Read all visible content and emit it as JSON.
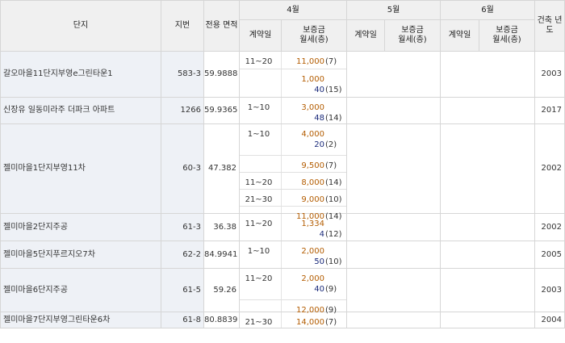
{
  "headers": {
    "complex": "단지",
    "jibun": "지번",
    "area": "전용 면적",
    "months": [
      "4월",
      "5월",
      "6월"
    ],
    "contract_date": "계약일",
    "deposit": "보증금",
    "rent": "월세(층)",
    "year_built": "건축 년도"
  },
  "rows": [
    {
      "name": "갈오마을11단지부영e그린타운1",
      "jibun": "583-3",
      "area": "59.9888",
      "year": "2003"
    },
    {
      "name": "신장유 일동미라주 더파크 아파트",
      "jibun": "1266",
      "area": "59.9365",
      "year": "2017"
    },
    {
      "name": "젤미마을1단지부영11차",
      "jibun": "60-3",
      "area": "47.382",
      "year": "2002"
    },
    {
      "name": "젤미마을2단지주공",
      "jibun": "61-3",
      "area": "36.38",
      "year": "2002"
    },
    {
      "name": "젤미마을5단지푸르지오7차",
      "jibun": "62-2",
      "area": "84.9941",
      "year": "2005"
    },
    {
      "name": "젤미마을6단지주공",
      "jibun": "61-5",
      "area": "59.26",
      "year": "2003"
    },
    {
      "name": "젤미마을7단지부영그린타운6차",
      "jibun": "61-8",
      "area": "80.8839",
      "year": "2004"
    }
  ],
  "april": [
    [
      {
        "date": "11~20",
        "deposit": "11,000",
        "floor": "(7)"
      },
      {
        "date": "",
        "deposit": "1,000",
        "rent": "40",
        "rent_floor": "(15)"
      }
    ],
    [
      {
        "date": "1~10",
        "deposit": "3,000",
        "rent": "48",
        "rent_floor": "(14)"
      }
    ],
    [
      {
        "date": "1~10",
        "deposit": "4,000",
        "rent": "20",
        "rent_floor": "(2)"
      },
      {
        "date": "",
        "deposit": "9,500",
        "floor": "(7)"
      },
      {
        "date": "11~20",
        "deposit": "8,000",
        "floor": "(14)"
      },
      {
        "date": "21~30",
        "deposit": "9,000",
        "floor": "(10)"
      },
      {
        "date": "",
        "deposit": "11,000",
        "floor": "(14)"
      }
    ],
    [
      {
        "date": "11~20",
        "deposit": "1,334",
        "rent": "4",
        "rent_floor": "(12)"
      }
    ],
    [
      {
        "date": "1~10",
        "deposit": "2,000",
        "rent": "50",
        "rent_floor": "(10)"
      }
    ],
    [
      {
        "date": "11~20",
        "deposit": "2,000",
        "rent": "40",
        "rent_floor": "(9)"
      },
      {
        "date": "",
        "deposit": "12,000",
        "floor": "(9)"
      }
    ],
    [
      {
        "date": "21~30",
        "deposit": "14,000",
        "floor": "(7)"
      }
    ]
  ]
}
